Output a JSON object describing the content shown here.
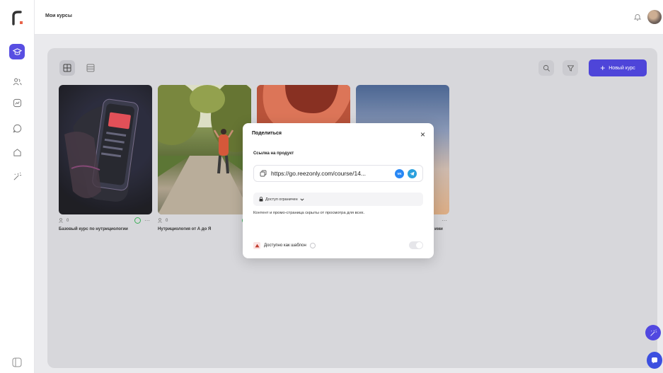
{
  "header": {
    "title": "Мои курсы"
  },
  "toolbar": {
    "new_course_label": "Новый курс",
    "new_course_icon": "plus-icon"
  },
  "courses": [
    {
      "name": "Базовый курс по нутрициологии",
      "students": "0"
    },
    {
      "name": "Нутрициология от А до Я",
      "students": "0"
    },
    {
      "name": "",
      "students": ""
    },
    {
      "name": "",
      "students": ""
    }
  ],
  "card4_partial_name": "ими",
  "share_modal": {
    "title": "Поделиться",
    "link_label": "Ссылка на продукт",
    "url": "https://go.reezonly.com/course/14...",
    "vk_label": "VK",
    "access_label": "Доступ ограничен",
    "access_description": "Контент и промо-страница скрыты от просмотра для всех.",
    "template_label": "Доступно как шаблон",
    "close_symbol": "×"
  },
  "colors": {
    "accent": "#3f36d6",
    "globe_green": "#2aa84a",
    "vk_blue": "#2787f5",
    "tg_blue": "#2aa0dd"
  }
}
